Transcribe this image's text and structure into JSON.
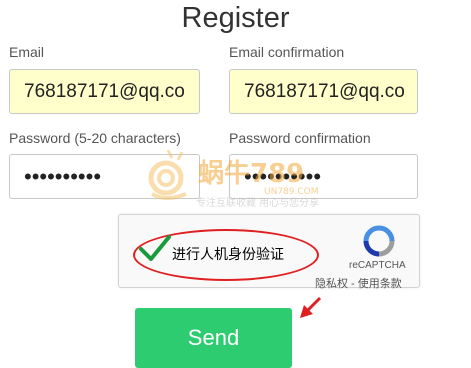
{
  "page": {
    "title": "Register"
  },
  "form": {
    "email_label": "Email",
    "email_value": "768187171@qq.co",
    "email_confirm_label": "Email confirmation",
    "email_confirm_value": "768187171@qq.co",
    "password_label": "Password (5-20 characters)",
    "password_value": "••••••••••",
    "password_confirm_label": "Password confirmation",
    "password_confirm_value": "••••••••••"
  },
  "captcha": {
    "prompt": "进行人机身份验证",
    "brand": "reCAPTCHA",
    "privacy_terms": "隐私权 - 使用条款",
    "check_color": "#1a9a3b"
  },
  "watermark": {
    "logo_text": "蜗牛789",
    "domain": "UN789.COM",
    "slogan": "专注互联收藏  用心与您分享"
  },
  "actions": {
    "send_label": "Send",
    "send_color": "#2ecc71"
  },
  "annotation": {
    "highlight_color": "#e02020"
  }
}
